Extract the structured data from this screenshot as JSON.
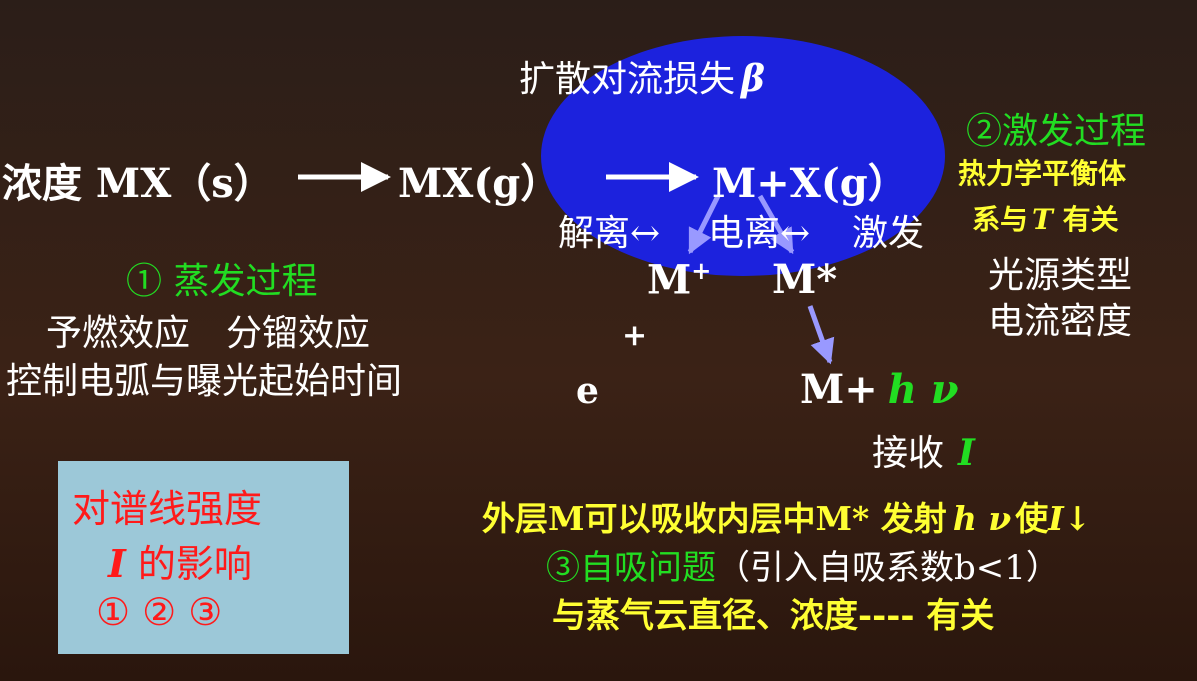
{
  "ellipse_title": "扩散对流损失",
  "ellipse_title_symbol": "β",
  "main_row": {
    "start": "浓度 MX（s）",
    "mid": "MX(g）",
    "end": "M+X(g）"
  },
  "processes": {
    "dissociation": "解离↔",
    "ionization": "电离↔",
    "excitation": "激发"
  },
  "m_plus": "M",
  "m_plus_sup": "+",
  "m_star": "M*",
  "plus": "+",
  "electron": "e",
  "emission": "M+",
  "emission_hv": "h ν",
  "absorb": "接收",
  "absorb_symbol": "I",
  "step1": {
    "title": "① 蒸发过程",
    "line1": "予燃效应　分镏效应",
    "line2": "控制电弧与曝光起始时间"
  },
  "step2": {
    "title": "②激发过程",
    "line1": "热力学平衡体",
    "line2a": "系与",
    "line2_t": "T",
    "line2b": " 有关",
    "line3": "光源类型",
    "line4": "电流密度"
  },
  "box": {
    "line1": "对谱线强度",
    "line2_i": "I",
    "line2": " 的影响",
    "line3": "①  ②  ③"
  },
  "step3": {
    "line1a": "外层M可以吸收内层中M* 发射",
    "line1_hv": "h ν",
    "line1b": "使",
    "line1_i": "I",
    "line1_arrow": "↓",
    "title": "③自吸问题",
    "title_note": "（引入自吸系数b<1）",
    "line3": "与蒸气云直径、浓度---- 有关"
  },
  "colors": {
    "ellipse": "#1c22dd",
    "box": "#9cc8d8",
    "green": "#22dd22",
    "yellow": "#ffff33",
    "red": "#ff1a1a",
    "arrow": "#9999ff"
  }
}
